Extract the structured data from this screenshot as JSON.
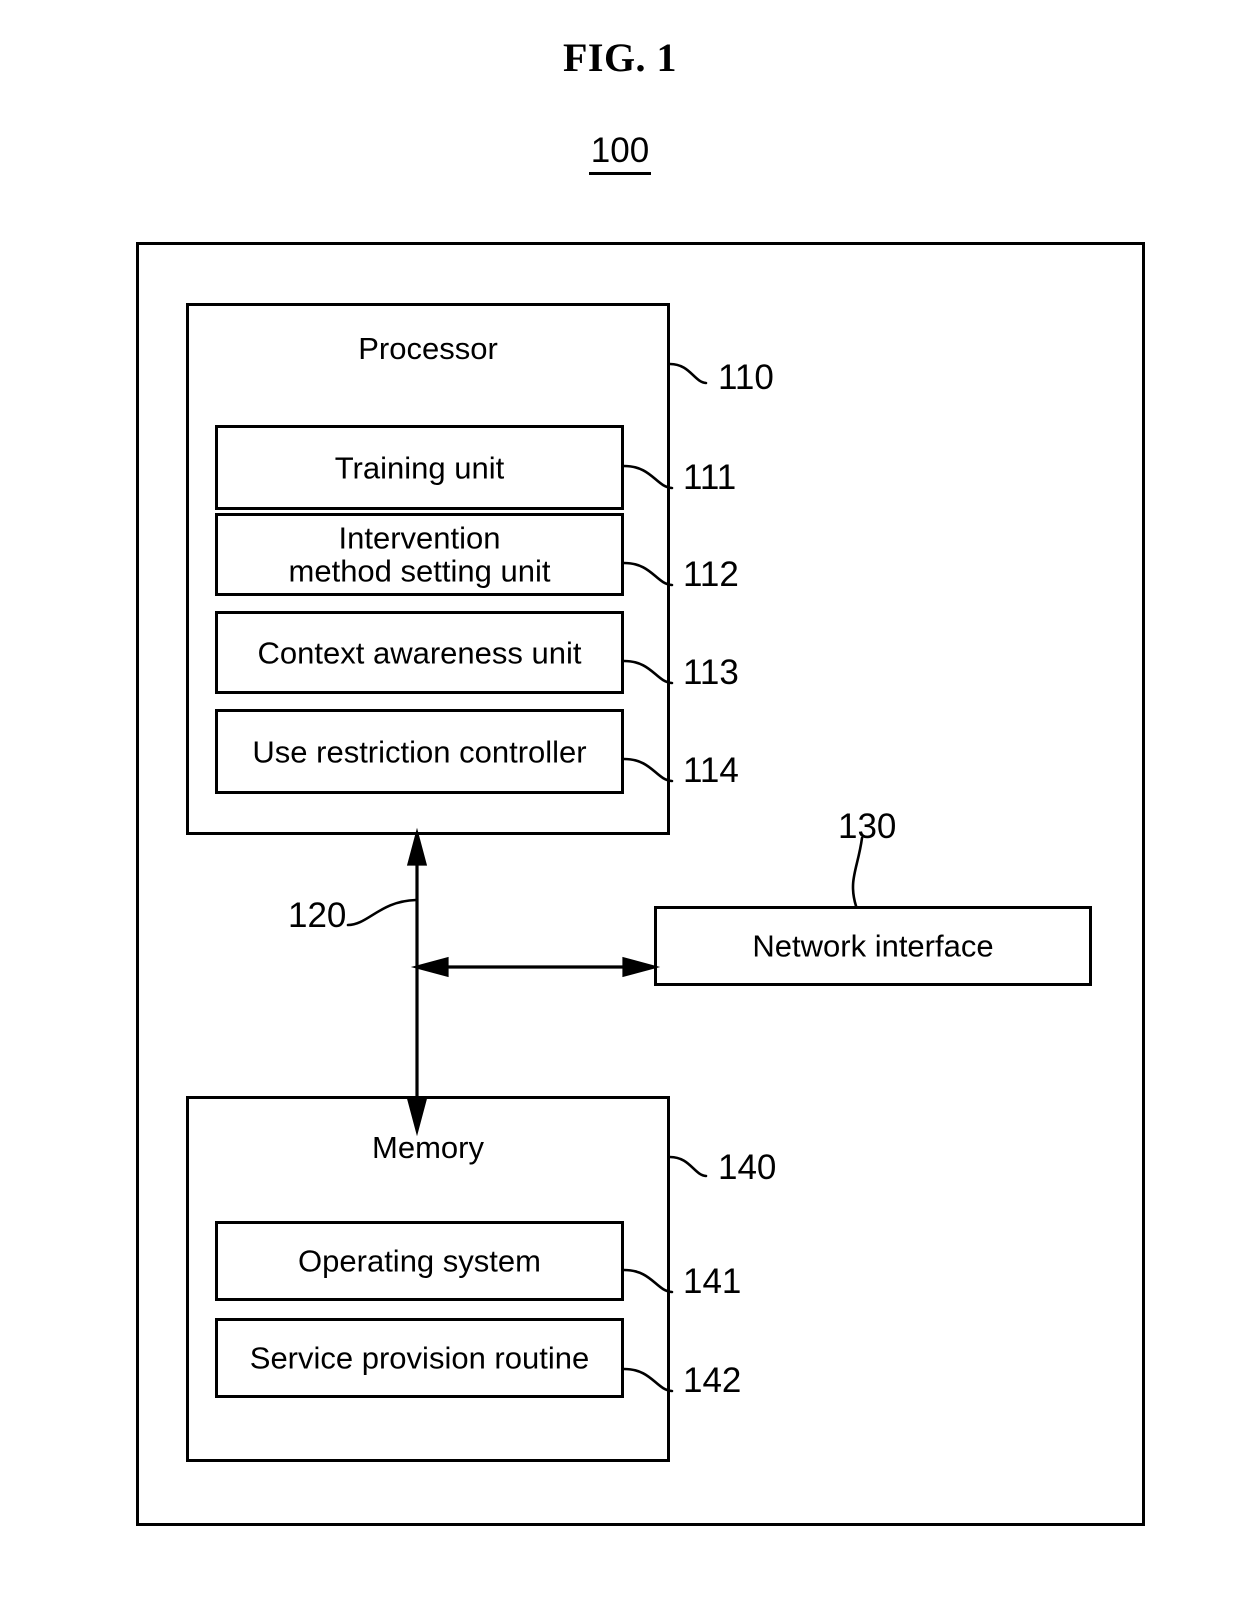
{
  "figure": {
    "title": "FIG. 1",
    "system_reference": "100"
  },
  "processor": {
    "title": "Processor",
    "reference": "110",
    "units": [
      {
        "label": "Training unit",
        "reference": "111"
      },
      {
        "label": "Intervention\nmethod setting unit",
        "line1": "Intervention",
        "line2": "method setting unit",
        "reference": "112"
      },
      {
        "label": "Context awareness unit",
        "reference": "113"
      },
      {
        "label": "Use restriction controller",
        "reference": "114"
      }
    ]
  },
  "bus": {
    "reference": "120"
  },
  "network_interface": {
    "label": "Network interface",
    "reference": "130"
  },
  "memory": {
    "title": "Memory",
    "reference": "140",
    "units": [
      {
        "label": "Operating system",
        "reference": "141"
      },
      {
        "label": "Service provision routine",
        "reference": "142"
      }
    ]
  },
  "colors": {
    "stroke": "#000000",
    "background": "#ffffff"
  }
}
